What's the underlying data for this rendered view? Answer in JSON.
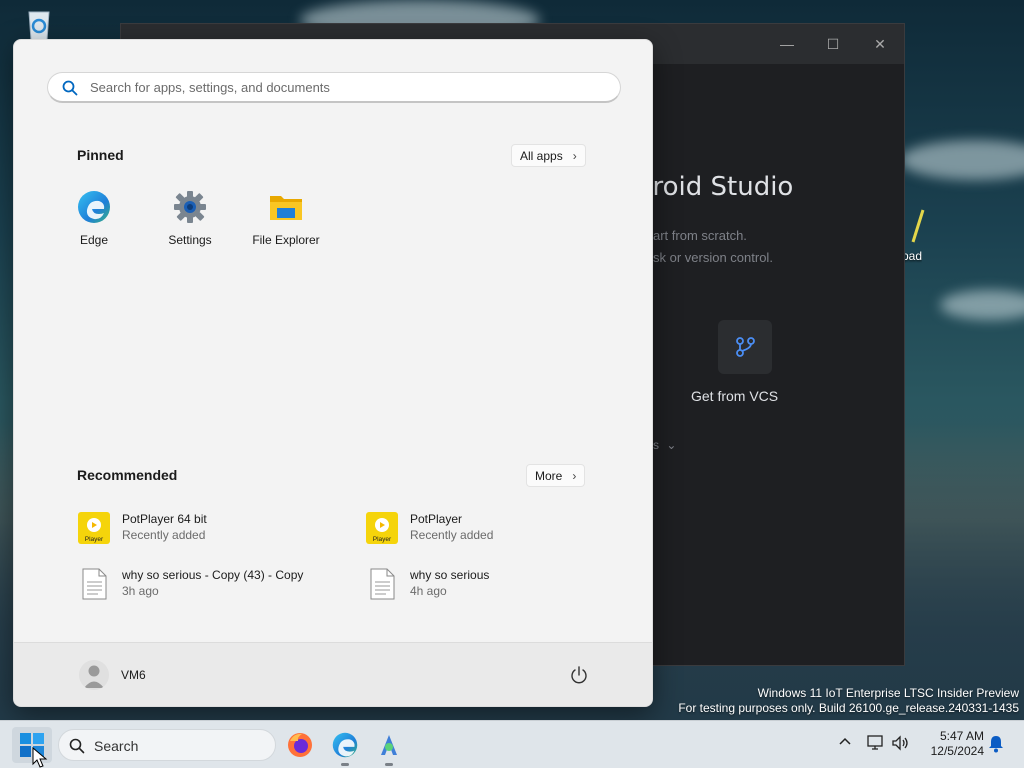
{
  "desktop": {
    "icons": [
      {
        "label": "Recycle Bin"
      },
      {
        "label": "Notepad++"
      }
    ],
    "watermark": {
      "line1": "Windows 11 IoT Enterprise LTSC Insider Preview",
      "line2": "For testing purposes only. Build 26100.ge_release.240331-1435"
    }
  },
  "android_studio": {
    "title_fragment": "droid Studio",
    "subtitle_line1": "art from scratch.",
    "subtitle_line2": "sk or version control.",
    "vcs_label": "Get from VCS",
    "more_fragment": "s"
  },
  "start_menu": {
    "search_placeholder": "Search for apps, settings, and documents",
    "pinned": {
      "title": "Pinned",
      "all_apps_label": "All apps",
      "items": [
        {
          "label": "Edge",
          "icon": "edge-icon"
        },
        {
          "label": "Settings",
          "icon": "settings-gear-icon"
        },
        {
          "label": "File Explorer",
          "icon": "folder-icon"
        }
      ]
    },
    "recommended": {
      "title": "Recommended",
      "more_label": "More",
      "items": [
        {
          "name": "PotPlayer 64 bit",
          "detail": "Recently added",
          "icon": "potplayer-icon"
        },
        {
          "name": "PotPlayer",
          "detail": "Recently added",
          "icon": "potplayer-icon"
        },
        {
          "name": "why so serious - Copy (43) - Copy",
          "detail": "3h ago",
          "icon": "document-icon"
        },
        {
          "name": "why so serious",
          "detail": "4h ago",
          "icon": "document-icon"
        }
      ]
    },
    "user": {
      "name": "VM6"
    },
    "potplayer_badge": "Player"
  },
  "taskbar": {
    "search_label": "Search",
    "apps": [
      {
        "icon": "firefox-icon"
      },
      {
        "icon": "edge-icon"
      },
      {
        "icon": "android-studio-icon"
      }
    ],
    "clock": {
      "time": "5:47 AM",
      "date": "12/5/2024"
    }
  },
  "colors": {
    "accent": "#0067c0",
    "potplayer": "#f5d40b",
    "folder": "#f2b90c",
    "android_bg": "#1e1f22"
  }
}
